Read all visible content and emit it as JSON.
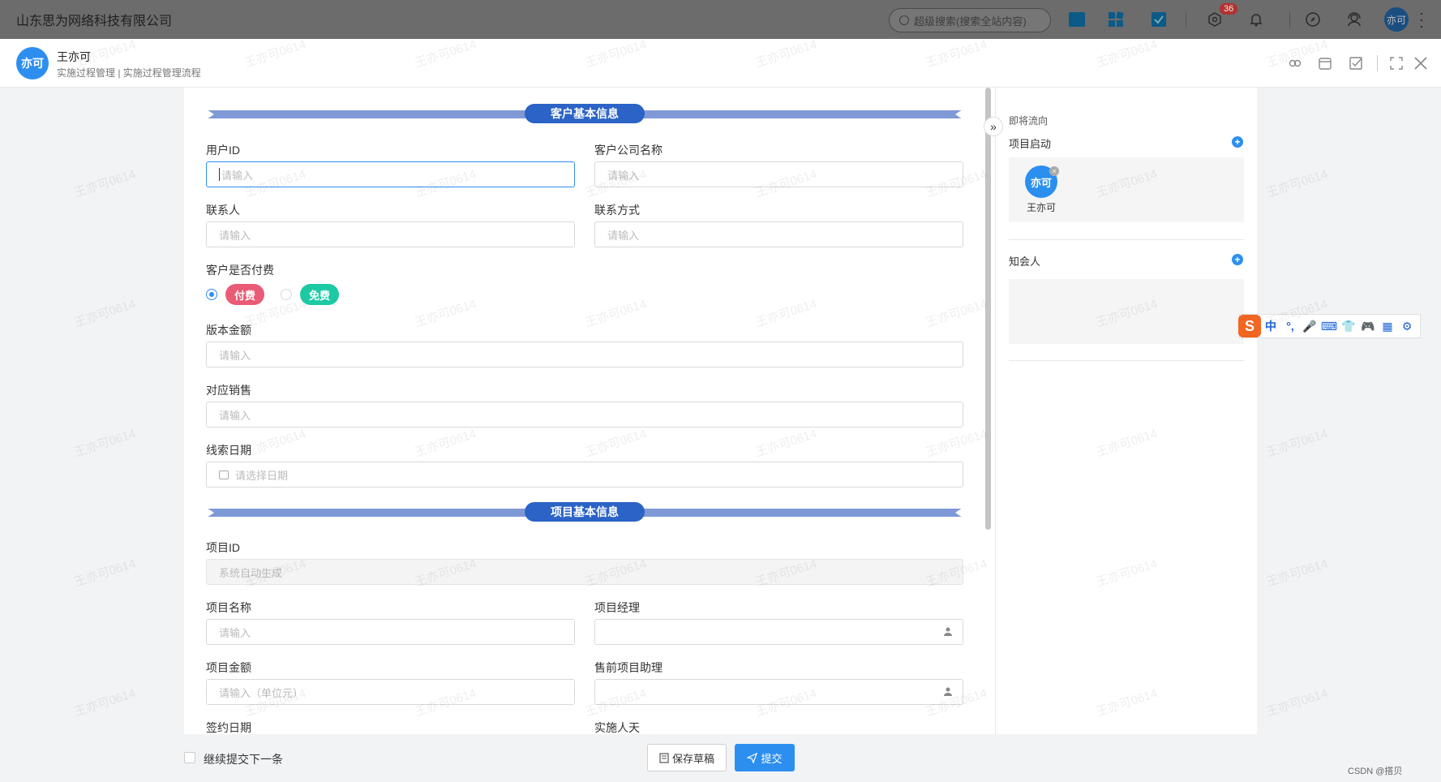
{
  "app": {
    "company": "山东思为网络科技有限公司",
    "search_placeholder": "超级搜索(搜索全站内容)",
    "notification_count": "36",
    "user_avatar": "亦可"
  },
  "header": {
    "avatar": "亦可",
    "name": "王亦可",
    "breadcrumb": "实施过程管理 | 实施过程管理流程"
  },
  "form": {
    "section1_title": "客户基本信息",
    "section2_title": "项目基本信息",
    "fields": {
      "user_id": {
        "label": "用户ID",
        "placeholder": "请输入"
      },
      "company_name": {
        "label": "客户公司名称",
        "placeholder": "请输入"
      },
      "contact": {
        "label": "联系人",
        "placeholder": "请输入"
      },
      "contact_method": {
        "label": "联系方式",
        "placeholder": "请输入"
      },
      "paid": {
        "label": "客户是否付费",
        "options": [
          "付费",
          "免费"
        ],
        "selected": "付费"
      },
      "version_amount": {
        "label": "版本金额",
        "placeholder": "请输入"
      },
      "sales": {
        "label": "对应销售",
        "placeholder": "请输入"
      },
      "lead_date": {
        "label": "线索日期",
        "placeholder": "请选择日期"
      },
      "project_id": {
        "label": "项目ID",
        "placeholder": "系统自动生成"
      },
      "project_name": {
        "label": "项目名称",
        "placeholder": "请输入"
      },
      "project_manager": {
        "label": "项目经理",
        "placeholder": ""
      },
      "project_amount": {
        "label": "项目金额",
        "placeholder": "请输入（单位元）"
      },
      "presales_assistant": {
        "label": "售前项目助理",
        "placeholder": ""
      },
      "sign_date": {
        "label": "签约日期"
      },
      "impl_days": {
        "label": "实施人天"
      }
    }
  },
  "side": {
    "flow_title": "即将流向",
    "step_label": "项目启动",
    "assignee_avatar": "亦可",
    "assignee_name": "王亦可",
    "cc_label": "知会人"
  },
  "ime": {
    "logo": "S",
    "items": [
      "中",
      "°,",
      "🎤",
      "⌨",
      "👕",
      "🎮",
      "▦",
      "⚙"
    ]
  },
  "footer": {
    "continue_label": "继续提交下一条",
    "save_draft": "保存草稿",
    "submit": "提交",
    "credit": "CSDN @搭贝"
  },
  "watermark": "王亦可0614",
  "colors": {
    "primary": "#2c8ff0",
    "banner_label": "#2b63c6",
    "banner_ribbon": "#7f99d6",
    "tag_paid": "#ea5b76",
    "tag_free": "#1dc9a5"
  }
}
